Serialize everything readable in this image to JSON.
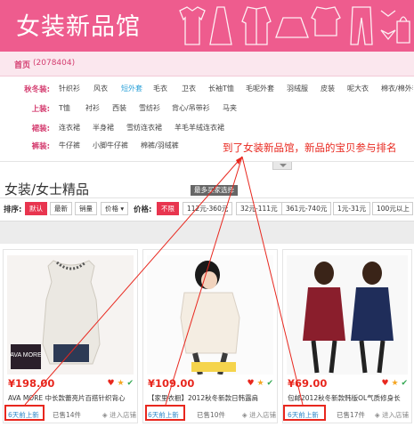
{
  "banner": {
    "title": "女装新品馆"
  },
  "breadcrumb": {
    "home": "首页",
    "count": "(2078404)"
  },
  "categories": [
    {
      "label": "秋冬装:",
      "items": [
        "针织衫",
        "风衣",
        "短外套",
        "毛衣",
        "卫衣",
        "长袖T恤",
        "毛呢外套",
        "羽绒服",
        "皮装",
        "呢大衣",
        "棉衣/棉外套"
      ],
      "active": "短外套"
    },
    {
      "label": "上装:",
      "items": [
        "T恤",
        "衬衫",
        "西装",
        "雪纺衫",
        "背心/吊带衫",
        "马夹"
      ]
    },
    {
      "label": "裙装:",
      "items": [
        "连衣裙",
        "半身裙",
        "雪纺连衣裙",
        "羊毛羊绒连衣裙"
      ]
    },
    {
      "label": "裤装:",
      "items": [
        "牛仔裤",
        "小脚牛仔裤",
        "棉裤/羽绒裤"
      ]
    }
  ],
  "annotation": "到了女装新品馆，新品的宝贝参与排名",
  "section_title": "女装/女士精品",
  "tooltip": "最多买家选择",
  "sort": {
    "label": "排序:",
    "options": [
      "默认",
      "最新",
      "销量",
      "价格"
    ],
    "price_label": "价格:",
    "price_options": [
      "不限",
      "112元-360元",
      "32元-111元",
      "361元-740元",
      "1元-31元",
      "100元以上"
    ]
  },
  "products": [
    {
      "price": "¥198.00",
      "name": "AVA MORE 中长款蕾亮片百搭针织背心",
      "new_label": "6天前上新",
      "sold": "已售14件",
      "shop": "进入店铺",
      "brand_mark": "AVA MORE"
    },
    {
      "price": "¥109.00",
      "name": "【家里衣橱】2012秋冬新款日韩露肩",
      "new_label": "6天前上新",
      "sold": "已售10件",
      "shop": "进入店铺"
    },
    {
      "price": "¥69.00",
      "name": "包邮2012秋冬新款韩版OL气质修身长",
      "new_label": "6天前上新",
      "sold": "已售17件",
      "shop": "进入店铺"
    }
  ],
  "colors": {
    "brand": "#ee5c8e",
    "annotation": "#e8271e",
    "price": "#e8271e",
    "new": "#2f88c9"
  }
}
